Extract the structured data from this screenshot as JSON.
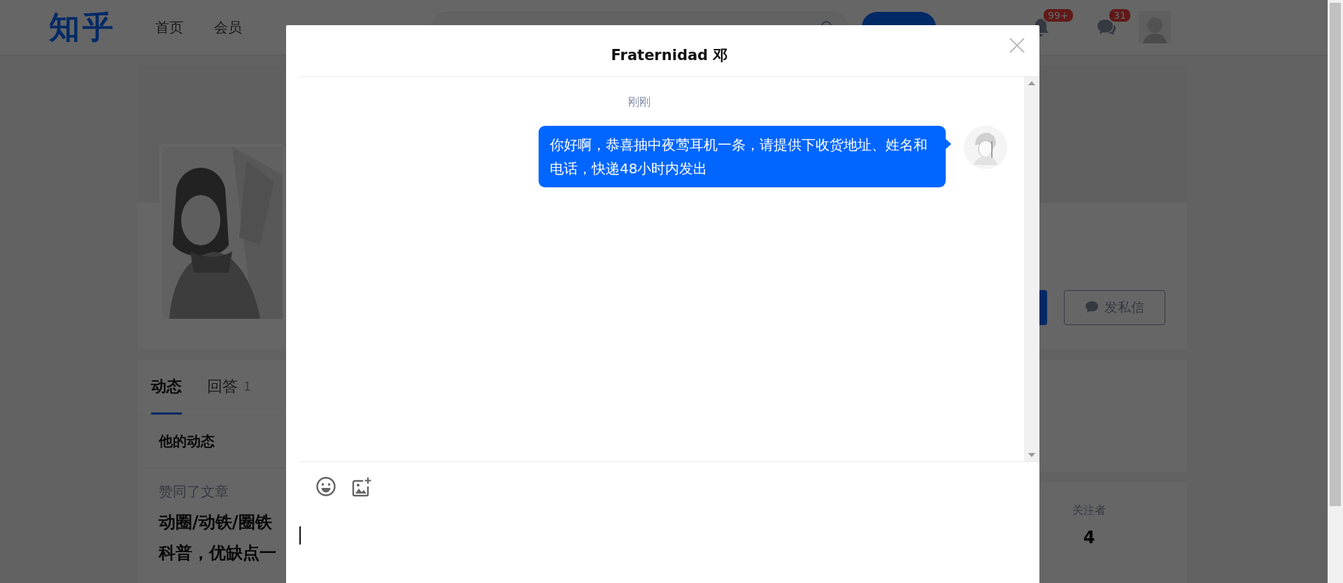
{
  "header": {
    "logo": "知乎",
    "nav": [
      {
        "label": "首页"
      },
      {
        "label": "会员"
      }
    ],
    "notifications": {
      "badge": "99+"
    },
    "messages": {
      "badge": "31"
    }
  },
  "profile": {
    "message_button": "发私信",
    "tabs": [
      {
        "label": "动态",
        "selected": true
      },
      {
        "label": "回答",
        "count": "1",
        "selected": false
      }
    ],
    "feed_heading": "他的动态",
    "activity": {
      "action": "赞同了文章",
      "title_lines": [
        "动圈/动铁/圈铁",
        "科普，优缺点一"
      ]
    },
    "followers": {
      "label": "关注者",
      "count": "4"
    }
  },
  "chat": {
    "title": "Fraternidad 邓",
    "messages": [
      {
        "time": "刚刚",
        "text": "你好啊，恭喜抽中夜莺耳机一条，请提供下收货地址、姓名和电话，快递48小时内发出"
      }
    ]
  }
}
